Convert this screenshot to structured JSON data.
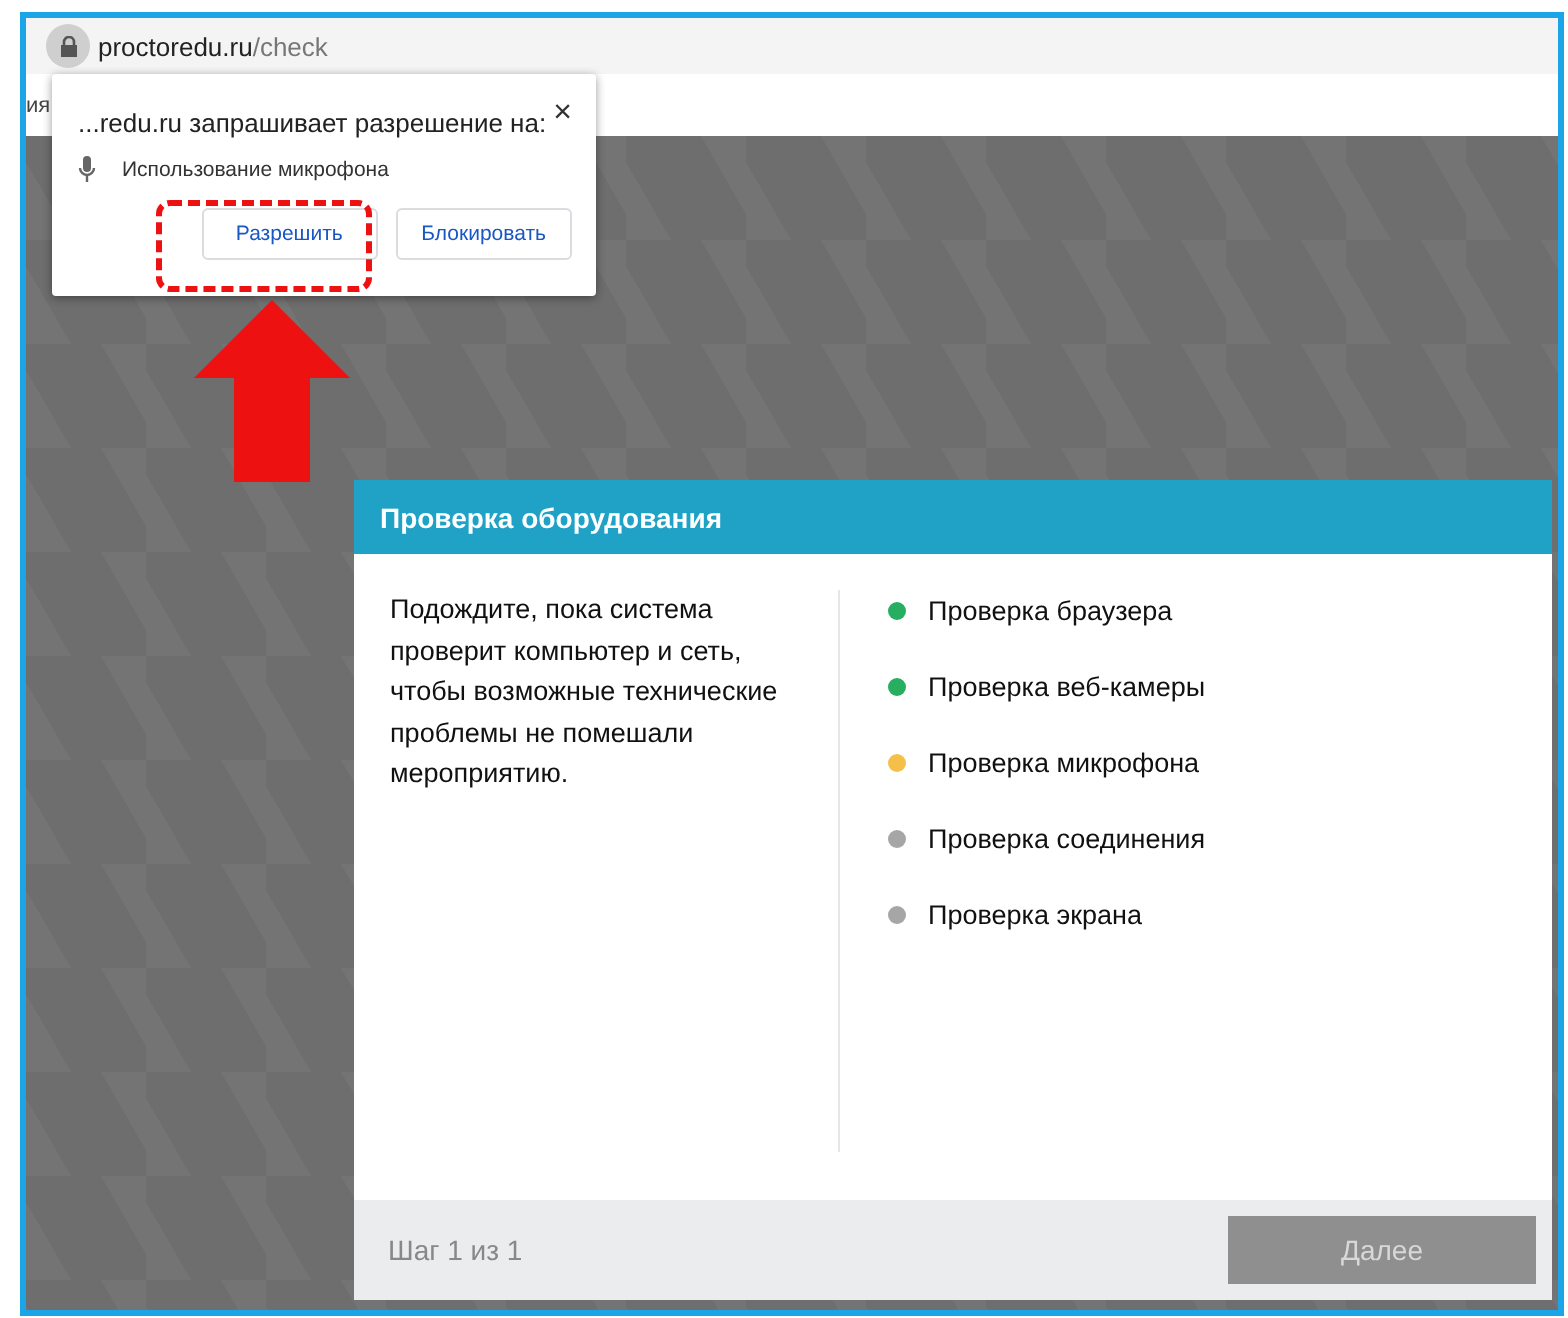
{
  "address_bar": {
    "host": "proctoredu.ru",
    "path": "/check"
  },
  "bookmarks_text": "ия",
  "permission_popup": {
    "title": "...redu.ru запрашивает разрешение на:",
    "close": "×",
    "permission": "Использование микрофона",
    "buttons": [
      {
        "label": "Разрешить",
        "highlighted": true
      },
      {
        "label": "Блокировать",
        "highlighted": false
      }
    ]
  },
  "dialog": {
    "title": "Проверка оборудования",
    "message": "Подождите, пока система проверит компьютер и сеть, чтобы возможные технические проблемы не помешали мероприятию.",
    "checks": [
      {
        "label": "Проверка браузера",
        "color": "#27ae60"
      },
      {
        "label": "Проверка веб-камеры",
        "color": "#27ae60"
      },
      {
        "label": "Проверка микрофона",
        "color": "#f5c04a"
      },
      {
        "label": "Проверка соединения",
        "color": "#a6a6a6"
      },
      {
        "label": "Проверка экрана",
        "color": "#a6a6a6"
      }
    ],
    "step": "Шаг 1 из 1",
    "next_button": {
      "label": "Далее",
      "disabled": true
    }
  }
}
